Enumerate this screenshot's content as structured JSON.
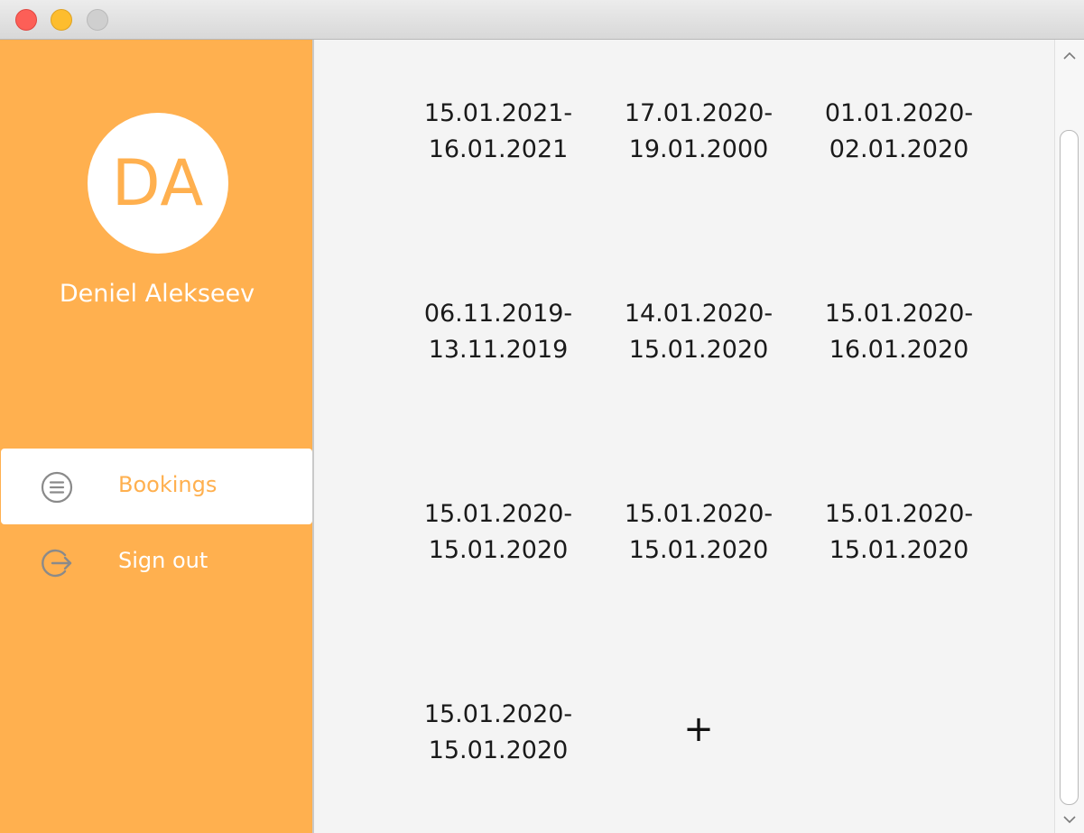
{
  "window": {
    "controls": {
      "close": "close",
      "minimize": "minimize",
      "maximize": "maximize"
    }
  },
  "sidebar": {
    "avatar_initials": "DA",
    "user_name": "Deniel Alekseev",
    "nav": [
      {
        "label": "Bookings",
        "icon": "list-circle-icon",
        "active": true
      },
      {
        "label": "Sign out",
        "icon": "sign-out-icon",
        "active": false
      }
    ]
  },
  "bookings": [
    {
      "start": "15.01.2021-",
      "end": "16.01.2021"
    },
    {
      "start": "17.01.2020-",
      "end": "19.01.2000"
    },
    {
      "start": "01.01.2020-",
      "end": "02.01.2020"
    },
    {
      "start": "06.11.2019-",
      "end": "13.11.2019"
    },
    {
      "start": "14.01.2020-",
      "end": "15.01.2020"
    },
    {
      "start": "15.01.2020-",
      "end": "16.01.2020"
    },
    {
      "start": "15.01.2020-",
      "end": "15.01.2020"
    },
    {
      "start": "15.01.2020-",
      "end": "15.01.2020"
    },
    {
      "start": "15.01.2020-",
      "end": "15.01.2020"
    },
    {
      "start": "15.01.2020-",
      "end": "15.01.2020"
    }
  ],
  "add_button": "+",
  "colors": {
    "accent": "#ffb04f",
    "content_bg": "#f4f4f4",
    "text": "#1a1a1a"
  }
}
